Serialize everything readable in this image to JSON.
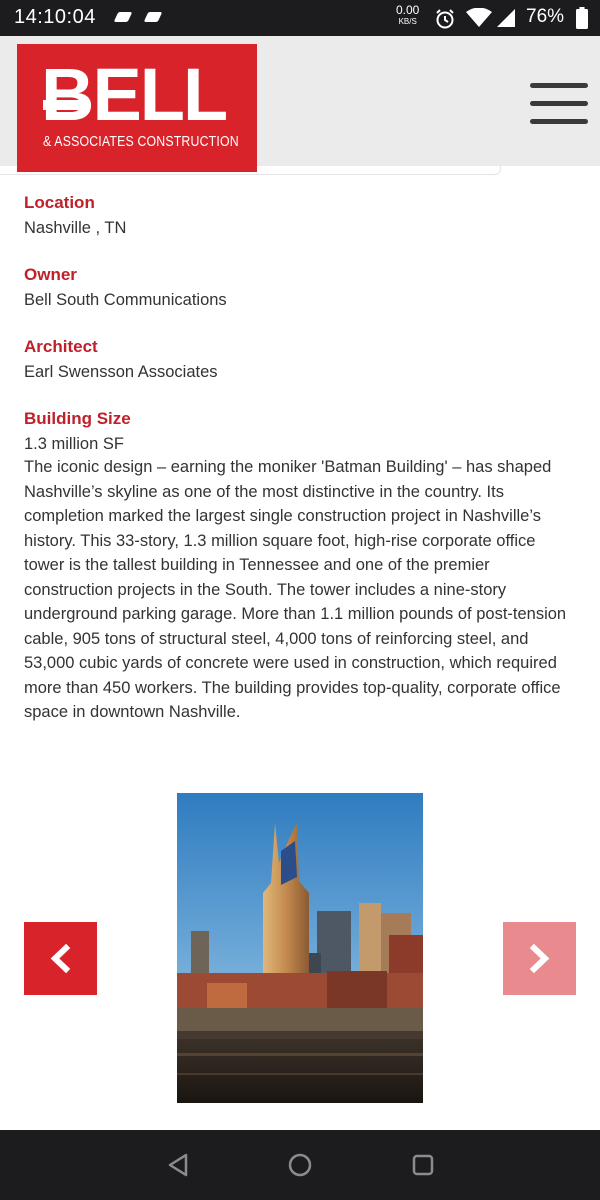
{
  "status_bar": {
    "time": "14:10:04",
    "net_speed": "0.00",
    "net_unit": "KB/S",
    "battery": "76%"
  },
  "header": {
    "logo_main": "BELL",
    "logo_sub": "& ASSOCIATES CONSTRUCTION"
  },
  "project": {
    "details": [
      {
        "label": "Location",
        "value": "Nashville , TN"
      },
      {
        "label": "Owner",
        "value": "Bell South Communications"
      },
      {
        "label": "Architect",
        "value": "Earl Swensson Associates"
      },
      {
        "label": "Building Size",
        "value": "1.3 million SF"
      }
    ],
    "description": "The iconic design – earning the moniker 'Batman Building' – has shaped Nashville’s skyline as one of the most distinctive in the country. Its completion marked the largest single construction project in Nashville’s history. This 33-story, 1.3 million square foot, high-rise corporate office tower is the tallest building in Tennessee and one of the premier construction projects in the South. The tower includes a nine-story underground parking garage. More than 1.1 million pounds of post-tension cable, 905 tons of structural steel, 4,000 tons of reinforcing steel, and 53,000 cubic yards of concrete were used in construction, which required more than 450 workers. The building provides top-quality, corporate office space in downtown Nashville."
  },
  "gallery": {
    "prev_icon": "chevron-left-icon",
    "next_icon": "chevron-right-icon"
  },
  "colors": {
    "brand_red": "#d8232a",
    "label_red": "#c0202a",
    "next_arrow_pink": "#e88a8e",
    "header_bg": "#ebebeb"
  }
}
